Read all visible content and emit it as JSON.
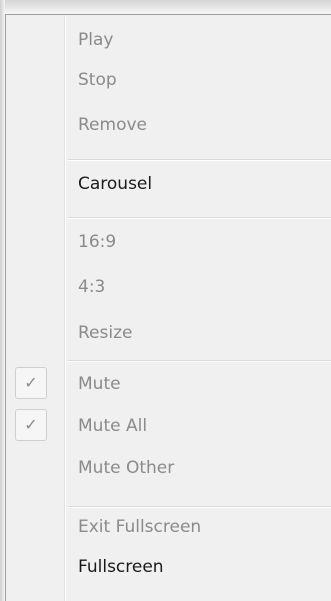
{
  "menu": {
    "group1": [
      {
        "label": "Play",
        "enabled": false
      },
      {
        "label": "Stop",
        "enabled": false
      },
      {
        "label": "Remove",
        "enabled": false
      }
    ],
    "group2": [
      {
        "label": "Carousel",
        "enabled": true
      }
    ],
    "group3": [
      {
        "label": "16:9",
        "enabled": false
      },
      {
        "label": "4:3",
        "enabled": false
      },
      {
        "label": "Resize",
        "enabled": false
      }
    ],
    "group4": [
      {
        "label": "Mute",
        "enabled": false,
        "checked": true
      },
      {
        "label": "Mute All",
        "enabled": false,
        "checked": true
      },
      {
        "label": "Mute Other",
        "enabled": false,
        "checked": false
      }
    ],
    "group5": [
      {
        "label": "Exit Fullscreen",
        "enabled": false
      },
      {
        "label": "Fullscreen",
        "enabled": true
      }
    ],
    "check_glyph": "✓"
  }
}
